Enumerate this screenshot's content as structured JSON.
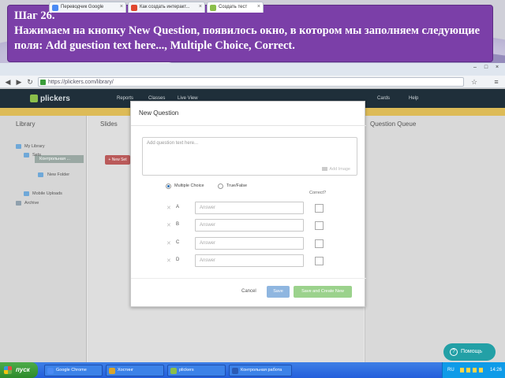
{
  "slide": {
    "step": "Шаг 26.",
    "instruction": "Нажимаем на кнопку New Question, появилось окно, в котором мы заполняем следующие поля: Add guestion text here..., Multiple Choice, Correct."
  },
  "browser": {
    "tabs": [
      {
        "label": "Переводчик Google",
        "color": "#4a8af4"
      },
      {
        "label": "Как создать интеракт...",
        "color": "#e1472e"
      },
      {
        "label": "Создать тест",
        "color": "#8bbf4a"
      }
    ],
    "url": "https://plickers.com/library/"
  },
  "app": {
    "logo": "plickers",
    "nav": [
      "Reports",
      "Classes",
      "Live View"
    ],
    "nav_right": [
      "Cards",
      "Help"
    ],
    "sidebar": {
      "title": "Library",
      "items": [
        {
          "label": "My Library"
        },
        {
          "label": "Sets"
        },
        {
          "label": "Контрольная ..."
        },
        {
          "label": "New Folder"
        },
        {
          "label": "Mobile Uploads"
        },
        {
          "label": "Archive"
        }
      ]
    },
    "columns": {
      "sets": "Slides",
      "queue": "Question Queue"
    },
    "new_set_button": "+ New Set"
  },
  "modal": {
    "title": "New Question",
    "question_placeholder": "Add question text here...",
    "add_image": "Add Image",
    "types": [
      "Multiple Choice",
      "True/False"
    ],
    "selected_type": "Multiple Choice",
    "correct_label": "Correct?",
    "answers": [
      {
        "letter": "A",
        "placeholder": "Answer"
      },
      {
        "letter": "B",
        "placeholder": "Answer"
      },
      {
        "letter": "C",
        "placeholder": "Answer"
      },
      {
        "letter": "D",
        "placeholder": "Answer"
      }
    ],
    "cancel": "Cancel",
    "save": "Save",
    "save_new": "Save and Create New"
  },
  "help_button": "Помощь",
  "taskbar": {
    "start": "пуск",
    "tasks": [
      {
        "label": "Google Chrome",
        "color": "#4a8af4"
      },
      {
        "label": "Хостинг",
        "color": "#d9a52a"
      },
      {
        "label": "plickers",
        "color": "#8bbf4a"
      },
      {
        "label": "Контрольная работа",
        "color": "#2b5bb5"
      }
    ],
    "lang": "RU",
    "clock": "14:26"
  },
  "colors": {
    "banner": "#7b3fa8",
    "save": "#8fb6e0",
    "save_new": "#9bd28c",
    "help": "#23a0a6"
  }
}
